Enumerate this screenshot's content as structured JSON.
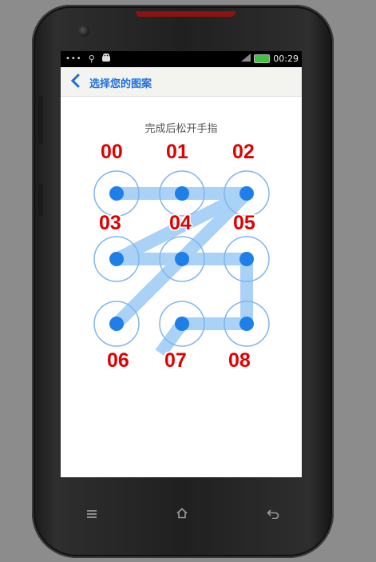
{
  "status_bar": {
    "notifications": "•••",
    "time": "00:29"
  },
  "header": {
    "back_icon": "chevron-left-icon",
    "title": "选择您的图案"
  },
  "hint": "完成后松开手指",
  "pattern": {
    "labels": [
      "00",
      "01",
      "02",
      "03",
      "04",
      "05",
      "06",
      "07",
      "08"
    ],
    "path": [
      "02",
      "04",
      "06"
    ],
    "accent_color": "#1f7fe8",
    "label_color": "#e00000"
  },
  "nav_bar": {
    "buttons": [
      "menu-icon",
      "home-icon",
      "back-icon"
    ]
  }
}
